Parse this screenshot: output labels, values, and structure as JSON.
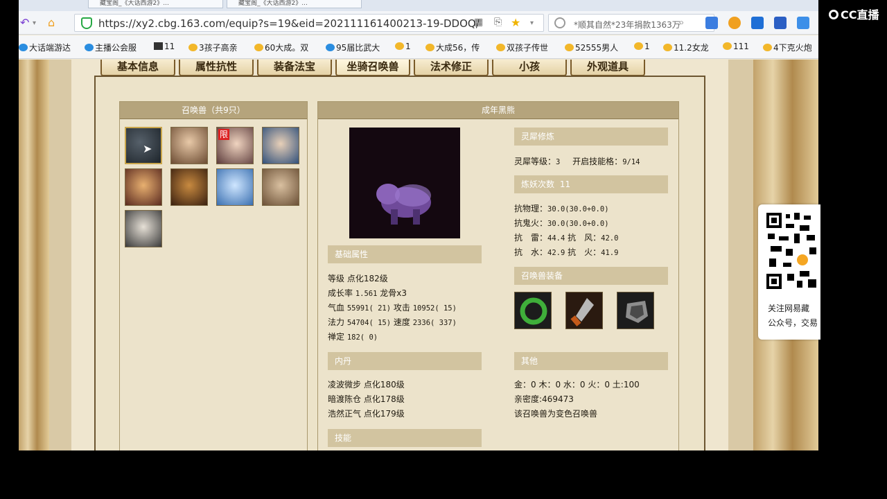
{
  "browser": {
    "tabs": [
      "藏宝阁_《大话西游2》...",
      "藏宝阁_《大话西游2》..."
    ],
    "url": "https://xy2.cbg.163.com/equip?s=19&eid=202111161400213-19-DDOQ/",
    "search_text": "*顺其自然*23年捐款1363万",
    "bookmarks": [
      "大话端游达",
      "主播公会服",
      "11",
      "3孩子高亲",
      "60大成。双",
      "95届比武大",
      "1",
      "大成56，传",
      "双孩子传世",
      "52555男人",
      "1",
      "11.2女龙",
      "111",
      "4下克火炮"
    ]
  },
  "tabs": [
    "基本信息",
    "属性抗性",
    "装备法宝",
    "坐骑召唤兽",
    "法术修正",
    "小孩",
    "外观道具"
  ],
  "active_tab": "坐骑召唤兽",
  "pet_list": {
    "title": "召唤兽（共9只）",
    "lock_badge": "限"
  },
  "detail": {
    "title": "成年黑熊",
    "basic": {
      "header": "基础属性",
      "level": "等级 点化182级",
      "growth_label": "成长率",
      "growth_value": "1.561",
      "dragon_bone": "龙骨x3",
      "hp_label": "气血",
      "hp_value": "55991( 21)",
      "attack_label": "攻击",
      "attack_value": "10952( 15)",
      "mp_label": "法力",
      "mp_value": "54704( 15)",
      "speed_label": "速度",
      "speed_value": "2336( 337)",
      "zen_label": "禅定",
      "zen_value": "182( 0)"
    },
    "neidan": {
      "header": "内丹",
      "items": [
        "凌波微步 点化180级",
        "暗渡陈仓 点化178级",
        "浩然正气 点化179级"
      ]
    },
    "skills": {
      "header": "技能"
    },
    "lingxi": {
      "header": "灵犀修炼",
      "level_label": "灵犀等级：",
      "level_value": "3",
      "slots_label": "开启技能格：",
      "slots_value": "9/14"
    },
    "refine": {
      "header": "炼妖次数",
      "count": "11"
    },
    "resist": {
      "phys_label": "抗物理：",
      "phys_value": "30.0(30.0+0.0)",
      "ghost_label": "抗鬼火：",
      "ghost_value": "30.0(30.0+0.0)",
      "thunder_label": "抗　雷：",
      "thunder_value": "44.4",
      "wind_label": "抗　风：",
      "wind_value": "42.0",
      "water_label": "抗　水：",
      "water_value": "42.9",
      "fire_label": "抗　火：",
      "fire_value": "41.9"
    },
    "equipment": {
      "header": "召唤兽装备"
    },
    "other": {
      "header": "其他",
      "elements": "金：0 木：0 水：0 火：0 土:100",
      "intimacy": "亲密度:469473",
      "note": "该召唤兽为变色召唤兽"
    }
  },
  "overlay": {
    "qr_line1": "关注网易藏",
    "qr_line2": "公众号，交易",
    "cc_logo": "CC直播"
  },
  "colors": {
    "panel_header": "#b5a47c",
    "section_bar": "#d2c4a0",
    "page_bg": "#efe6cf"
  }
}
